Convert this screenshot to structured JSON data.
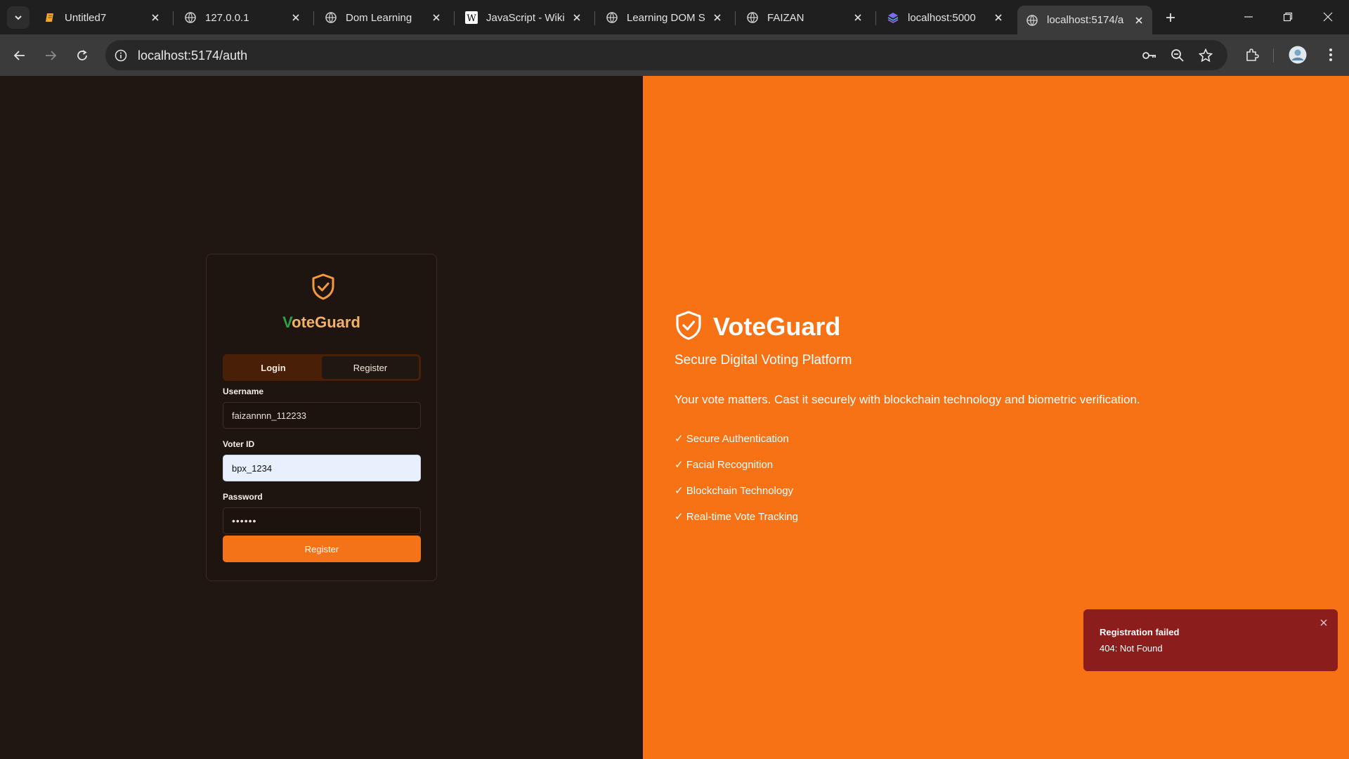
{
  "browser": {
    "tabs": [
      {
        "title": "Untitled7",
        "favicon": "notebook-icon"
      },
      {
        "title": "127.0.0.1",
        "favicon": "globe-icon"
      },
      {
        "title": "Dom Learning",
        "favicon": "globe-icon"
      },
      {
        "title": "JavaScript - Wiki",
        "favicon": "wikipedia-icon"
      },
      {
        "title": "Learning DOM S",
        "favicon": "globe-icon"
      },
      {
        "title": "FAIZAN",
        "favicon": "globe-icon"
      },
      {
        "title": "localhost:5000",
        "favicon": "stack-icon"
      },
      {
        "title": "localhost:5174/a",
        "favicon": "globe-icon",
        "active": true
      }
    ],
    "address": "localhost:5174/auth"
  },
  "card": {
    "brand_first": "V",
    "brand_rest": "oteGuard",
    "tab_login": "Login",
    "tab_register": "Register",
    "username_label": "Username",
    "username_value": "faizannnn_112233",
    "voter_label": "Voter ID",
    "voter_value": "bpx_1234",
    "password_label": "Password",
    "password_value": "••••••",
    "submit_label": "Register"
  },
  "hero": {
    "title": "VoteGuard",
    "subtitle": "Secure Digital Voting Platform",
    "description": "Your vote matters. Cast it securely with blockchain technology and biometric verification.",
    "features": [
      "✓ Secure Authentication",
      "✓ Facial Recognition",
      "✓ Blockchain Technology",
      "✓ Real-time Vote Tracking"
    ]
  },
  "toast": {
    "title": "Registration failed",
    "description": "404: Not Found"
  },
  "colors": {
    "accent": "#f77214",
    "left_bg": "#201612",
    "toast_bg": "#8b1d1d",
    "brand_green": "#2ea043"
  }
}
